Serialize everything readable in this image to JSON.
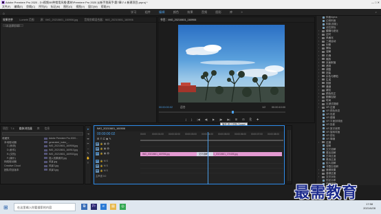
{
  "window": {
    "title": "Adobe Premiere Pro 2020 - D:\\视频\\59种常用风格\\素材\\Premiere Pro 2020 从新手到高手\\第7章\\7.4 新建项目.prproj *",
    "controls": "—   □   ✕"
  },
  "menu": [
    "文件(F)",
    "编辑(E)",
    "剪辑(C)",
    "序列(S)",
    "标记(M)",
    "图形(G)",
    "视图(V)",
    "窗口(W)",
    "帮助(H)"
  ],
  "workspaces": {
    "tabs": [
      "学习",
      "组件",
      "编辑",
      "颜色",
      "效果",
      "音频",
      "图形",
      "库"
    ],
    "active_index": 2,
    "more": "»"
  },
  "source_panel": {
    "tabs": [
      "效果控件",
      "Lumetri 范围",
      "源：IMG_20210601_160906.jpg",
      "音频剪辑混合器：IMG_20210601_160906"
    ],
    "active_index": 0,
    "clip_label": "（未选择剪辑）"
  },
  "program_monitor": {
    "tab": "节目：IMG_20210601_160906",
    "timecode_left": "00:00:00:02",
    "fit": "适合",
    "scale": "1/2",
    "timecode_right": "00:00:10:00",
    "controls": [
      "{",
      "}",
      "|◀",
      "◀|",
      "▶",
      "|▶",
      "▶|",
      "⊞",
      "⊟",
      "⎘",
      "✚"
    ],
    "tooltip": "播放-停止切换 (Space)"
  },
  "effects_panel": {
    "items": [
      {
        "label": "斜面Alpha",
        "type": "effect"
      },
      {
        "label": "边缘斜面",
        "type": "effect"
      },
      {
        "label": "阴影(投影)",
        "type": "effect"
      },
      {
        "label": "线性擦除",
        "type": "effect"
      },
      {
        "label": "模糊与锐化",
        "type": "folder"
      },
      {
        "label": "过时",
        "type": "folder"
      },
      {
        "label": "风格化",
        "type": "folder"
      },
      {
        "label": "三维运动",
        "type": "folder"
      },
      {
        "label": "划像",
        "type": "folder"
      },
      {
        "label": "擦除",
        "type": "folder"
      },
      {
        "label": "溶解",
        "type": "folder"
      },
      {
        "label": "内滑",
        "type": "folder"
      },
      {
        "label": "缩放",
        "type": "folder"
      },
      {
        "label": "页面剥落",
        "type": "folder"
      },
      {
        "label": "透视",
        "type": "folder"
      },
      {
        "label": "调整",
        "type": "folder"
      },
      {
        "label": "扭曲",
        "type": "folder"
      },
      {
        "label": "杂色与颗粒",
        "type": "folder"
      },
      {
        "label": "生成",
        "type": "folder"
      },
      {
        "label": "视频",
        "type": "folder"
      },
      {
        "label": "通道",
        "type": "folder"
      },
      {
        "label": "键控",
        "type": "folder"
      },
      {
        "label": "颜色校正",
        "type": "folder"
      },
      {
        "label": "图像控制",
        "type": "folder"
      },
      {
        "label": "时间",
        "type": "folder"
      },
      {
        "label": "沉浸式视频",
        "type": "folder"
      },
      {
        "label": "VR 过渡",
        "type": "folder"
      },
      {
        "label": "VR 颜色渐变",
        "type": "effect"
      },
      {
        "label": "VR 色差",
        "type": "effect"
      },
      {
        "label": "VR 模糊",
        "type": "effect"
      },
      {
        "label": "VR 平面到球面",
        "type": "effect"
      },
      {
        "label": "VR 投影",
        "type": "effect"
      },
      {
        "label": "VR 数字故障",
        "type": "effect"
      },
      {
        "label": "VR 旋转球面",
        "type": "effect"
      },
      {
        "label": "VR 锐化",
        "type": "effect"
      },
      {
        "label": "VR 降噪",
        "type": "effect"
      },
      {
        "label": "过渡",
        "type": "folder"
      },
      {
        "label": "溶解",
        "type": "effect"
      },
      {
        "label": "交叉溶解",
        "type": "effect"
      },
      {
        "label": "叠加溶解",
        "type": "effect"
      },
      {
        "label": "白场过渡",
        "type": "effect"
      },
      {
        "label": "黑场过渡",
        "type": "effect"
      },
      {
        "label": "胶片溶解",
        "type": "effect"
      },
      {
        "label": "非叠加溶解",
        "type": "effect"
      },
      {
        "label": "音频效果",
        "type": "folder"
      },
      {
        "label": "音频过渡",
        "type": "folder"
      },
      {
        "label": "交叉淡化",
        "type": "folder"
      },
      {
        "label": "恒定功率",
        "type": "effect"
      },
      {
        "label": "恒定增益",
        "type": "effect"
      },
      {
        "label": "指数淡化",
        "type": "effect"
      },
      {
        "label": "Lumetri 预设",
        "type": "folder"
      },
      {
        "label": "预设",
        "type": "folder"
      }
    ]
  },
  "project_panel": {
    "tabs": [
      "项目：7.4",
      "媒体浏览器",
      "库",
      "信息"
    ],
    "active_index": 1,
    "tree": [
      "收藏夹",
      "本地驱动器",
      "C:(系统)",
      "D:(软件)",
      "E:(文档)",
      "F:(娱乐)",
      "网络驱动器",
      "Creative Cloud",
      "团队项目版本"
    ],
    "files": [
      "Adobe Premiere Pro 2020...",
      "generated_index_...",
      "IMG_20210601_160906.jpg",
      "IMG_20210601_160910.jpg",
      "IMG_20210601_160930.jpg",
      "插入效果素材.jpg",
      "风景.jpg",
      "风景2.jpg",
      "风景3.jpg"
    ]
  },
  "timeline": {
    "tab": "IMG_20210601_160906",
    "timecode": "00:00:00:02",
    "ruler": [
      "00:00",
      "00:00:01:00",
      "00:00:02:00",
      "00:00:03:00",
      "00:00:04:00",
      "00:00:05:00",
      "00:00:06:00",
      "00:00:07:00",
      "00:00:08:00",
      "00:00:09:00"
    ],
    "tracks": [
      {
        "id": "V3",
        "label": "V3"
      },
      {
        "id": "V2",
        "label": "V2"
      },
      {
        "id": "V1",
        "label": "V1"
      },
      {
        "id": "A1",
        "label": "A1"
      },
      {
        "id": "A2",
        "label": "A2"
      },
      {
        "id": "A3",
        "label": "A3"
      },
      {
        "id": "M",
        "label": "主声道",
        "value": "0.0"
      }
    ],
    "clips": [
      {
        "label": "IMG_20210601_160906.jpg",
        "track": "V1"
      },
      {
        "label": "IMG_20210601_170405.jpg",
        "track": "V1"
      }
    ],
    "transition": "交叉溶解"
  },
  "taskbar": {
    "search_placeholder": "在这里输入你要搜索的内容",
    "time": "17:58",
    "date": "2021/6/28"
  },
  "watermark": "最需教育",
  "colors": {
    "accent": "#4b9fe9",
    "clip": "#e49ad2",
    "panel": "#232323"
  }
}
